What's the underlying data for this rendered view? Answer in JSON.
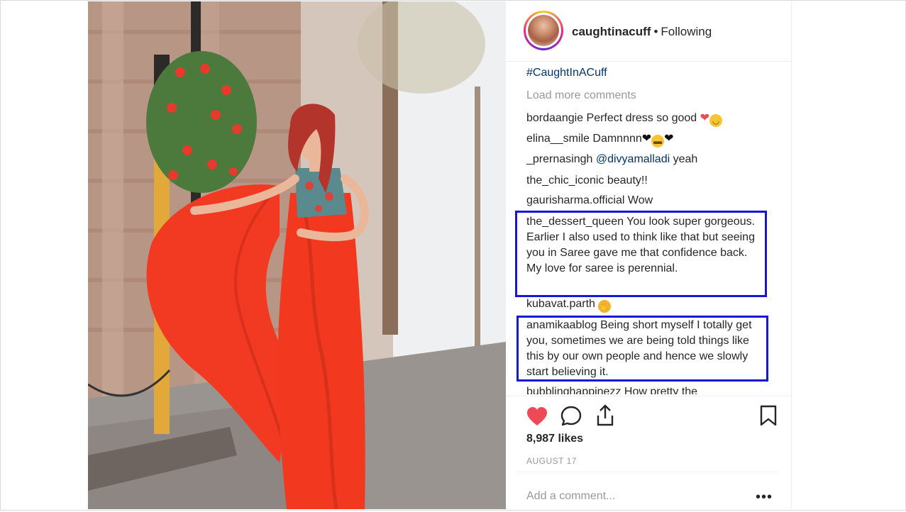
{
  "header": {
    "username": "caughtinacuff",
    "separator": "•",
    "follow_status": "Following"
  },
  "comments": {
    "hashtag": "#CaughtInACuff",
    "load_more": "Load more comments",
    "items": [
      {
        "user": "bordaangie",
        "text": "Perfect dress so good"
      },
      {
        "user": "elina__smile",
        "text": "Damnnnn"
      },
      {
        "user": "_prernasingh",
        "mention": "@divyamalladi",
        "text": "yeah"
      },
      {
        "user": "the_chic_iconic",
        "text": "beauty!!"
      },
      {
        "user": "gaurisharma.official",
        "text": "Wow"
      },
      {
        "user": "the_dessert_queen",
        "text": "You look super gorgeous. Earlier I also used to think like that but seeing you in Saree gave me that confidence back. My love for saree is perennial."
      },
      {
        "user": "kubavat.parth",
        "text": ""
      },
      {
        "user": "anamikaablog",
        "text": "Being short myself I totally get you, sometimes we are being told things like this by our own people and hence we slowly start believing it."
      },
      {
        "user": "bubblinghappinezz",
        "text": "How pretty the"
      }
    ]
  },
  "actions": {
    "likes": "8,987 likes",
    "date": "AUGUST 17",
    "add_comment_placeholder": "Add a comment...",
    "more": "•••",
    "colors": {
      "like_active": "#ed4956",
      "highlight_box": "#1616d8",
      "link": "#003569"
    },
    "icons": [
      "heart-icon",
      "comment-icon",
      "share-icon",
      "bookmark-icon"
    ]
  }
}
